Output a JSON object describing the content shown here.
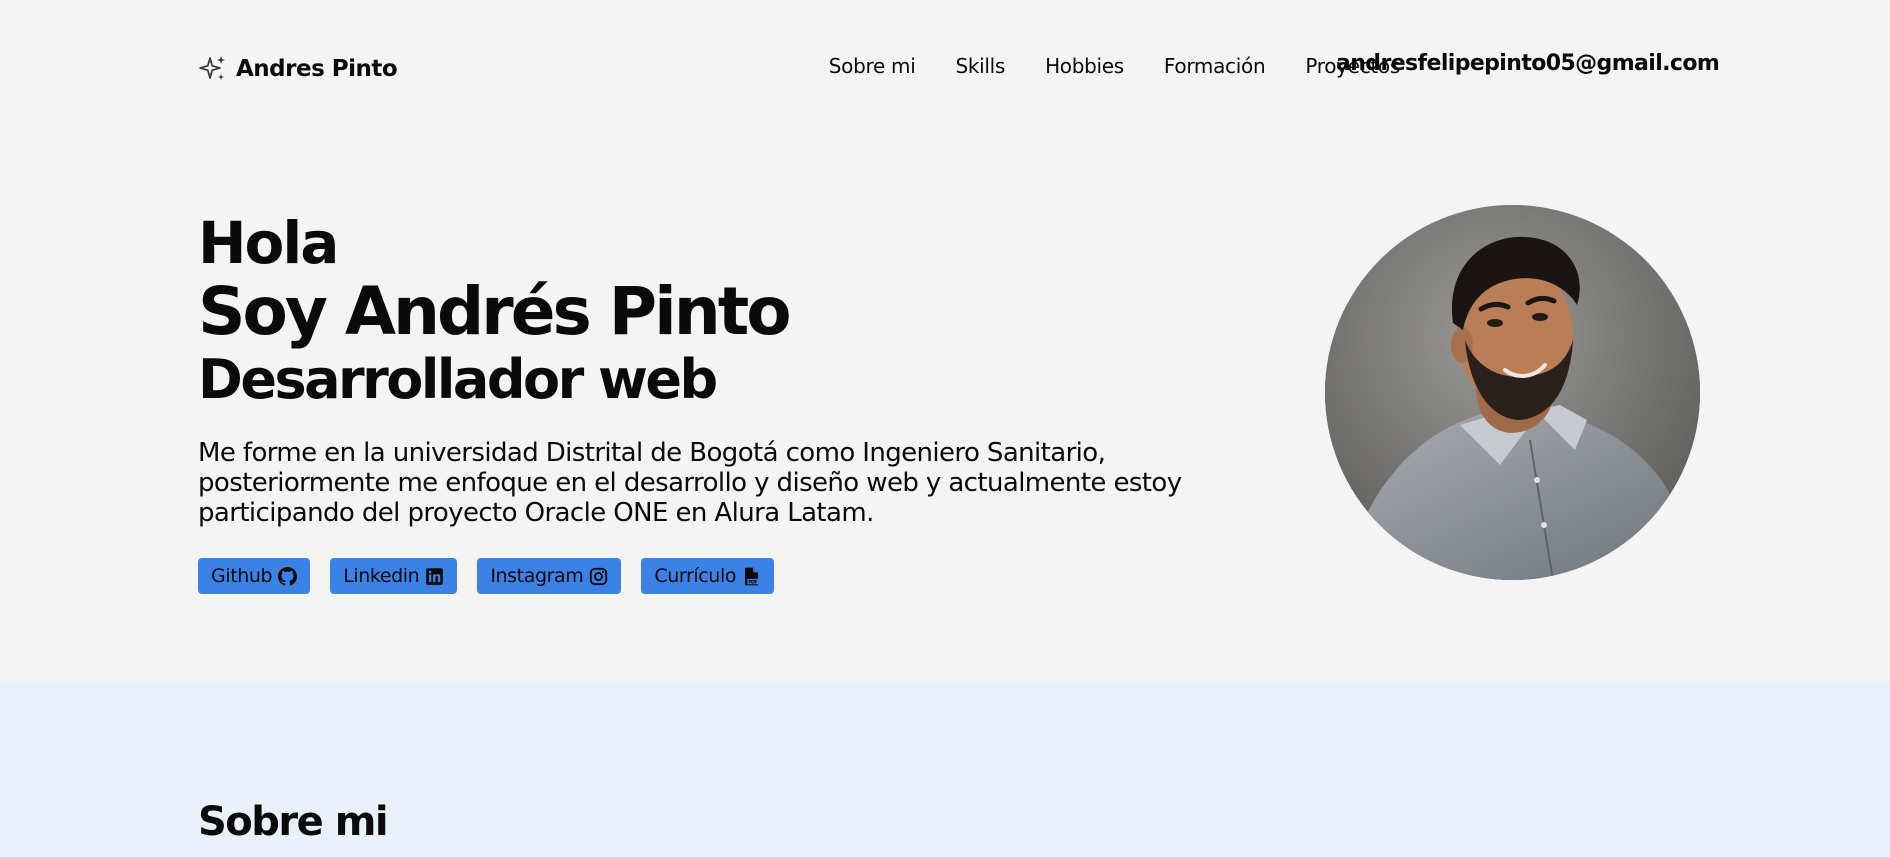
{
  "header": {
    "logo_text": "Andres Pinto",
    "nav": [
      {
        "label": "Sobre mi"
      },
      {
        "label": "Skills"
      },
      {
        "label": "Hobbies"
      },
      {
        "label": "Formación"
      },
      {
        "label": "Proyectos"
      }
    ],
    "email": "andresfelipepinto05@gmail.com"
  },
  "hero": {
    "greeting": "Hola",
    "name": "Soy Andrés Pinto",
    "role": "Desarrollador web",
    "bio": "Me forme en la universidad Distrital de Bogotá como Ingeniero Sanitario, posteriormente me enfoque en el desarrollo y diseño web y actualmente estoy participando del proyecto Oracle ONE en Alura Latam.",
    "buttons": [
      {
        "label": "Github",
        "icon": "github-icon"
      },
      {
        "label": "Linkedin",
        "icon": "linkedin-icon"
      },
      {
        "label": "Instagram",
        "icon": "instagram-icon"
      },
      {
        "label": "Currículo",
        "icon": "pdf-icon"
      }
    ]
  },
  "about": {
    "title": "Sobre mi"
  },
  "colors": {
    "background": "#f4f4f5",
    "accent": "#3b82e6",
    "about_background": "#eaf1fc",
    "text": "#0a0a0a"
  }
}
